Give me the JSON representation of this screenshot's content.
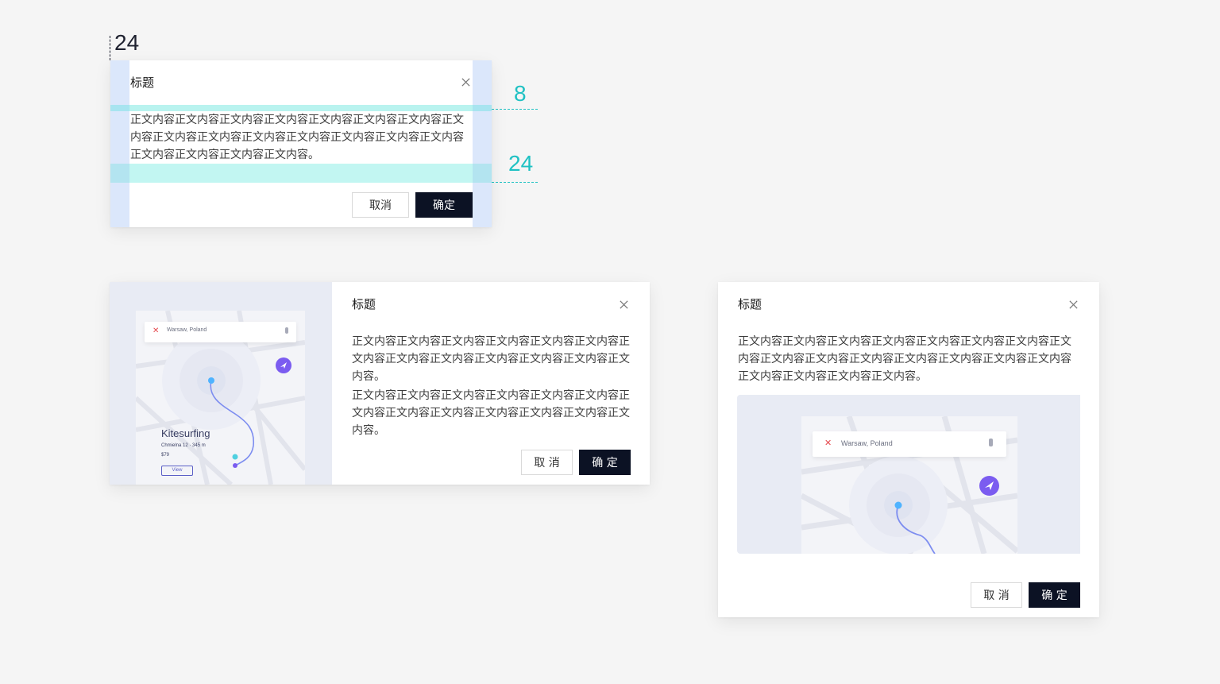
{
  "spec": {
    "left_padding": "24",
    "title_gap": "8",
    "footer_gap": "24"
  },
  "modal_basic": {
    "title": "标题",
    "body": "正文内容正文内容正文内容正文内容正文内容正文内容正文内容正文内容正文内容正文内容正文内容正文内容正文内容正文内容正文内容正文内容正文内容正文内容正文内容。",
    "cancel_label": "取消",
    "ok_label": "确定"
  },
  "modal_side_image": {
    "title": "标题",
    "body_p1": "正文内容正文内容正文内容正文内容正文内容正文内容正文内容正文内容正文内容正文内容正文内容正文内容正文内容。",
    "body_p2": "正文内容正文内容正文内容正文内容正文内容正文内容正文内容正文内容正文内容正文内容正文内容正文内容正文内容。",
    "cancel_label": "取 消",
    "ok_label": "确 定",
    "map": {
      "search_text": "Warsaw, Poland",
      "place_title": "Kitesurfing",
      "place_address": "Chmielna 12 · 345 m",
      "place_price": "$79",
      "view_label": "View"
    }
  },
  "modal_top_image": {
    "title": "标题",
    "body": "正文内容正文内容正文内容正文内容正文内容正文内容正文内容正文内容正文内容正文内容正文内容正文内容正文内容正文内容正文内容正文内容正文内容正文内容正文内容。",
    "cancel_label": "取 消",
    "ok_label": "确 定",
    "map": {
      "search_text": "Warsaw, Poland"
    }
  },
  "colors": {
    "primary_button": "#0c1224",
    "spec_teal": "#1fc1c3",
    "spec_band_blue": "#dbe7fb",
    "spec_band_teal": "#c2f6f2",
    "map_accent": "#7b5cf0",
    "map_dot": "#4fb3ff"
  }
}
